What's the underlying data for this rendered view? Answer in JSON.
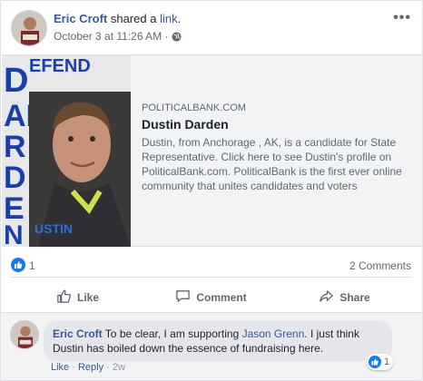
{
  "post": {
    "author": "Eric Croft",
    "action_text": " shared a ",
    "action_link": "link",
    "action_end": ".",
    "timestamp": "October 3 at 11:26 AM",
    "separator": " · ",
    "audience_icon": "globe-icon",
    "more_icon": "more-options-icon"
  },
  "attachment": {
    "thumbnail_words": [
      "DEFEND",
      "DAKARDEN",
      "USTIN"
    ],
    "domain": "POLITICALBANK.COM",
    "title": "Dustin Darden",
    "description": "Dustin, from Anchorage , AK, is a candidate for State Representative. Click here to see Dustin's profile on PoliticalBank.com. PoliticalBank is the first ever online community that unites candidates and voters"
  },
  "stats": {
    "likes": "1",
    "comments": "2 Comments"
  },
  "actions": {
    "like": "Like",
    "comment": "Comment",
    "share": "Share"
  },
  "comment": {
    "author": "Eric Croft",
    "text_before": " To be clear, I am supporting ",
    "mention": "Jason Grenn",
    "text_after": ". I just think Dustin has boiled down the essence of fundraising here.",
    "like_label": "Like",
    "dot": " · ",
    "reply_label": "Reply",
    "time": "2w",
    "reaction_count": "1"
  },
  "colors": {
    "link": "#385898",
    "brand_blue": "#1877f2",
    "secondary_text": "#606770"
  }
}
